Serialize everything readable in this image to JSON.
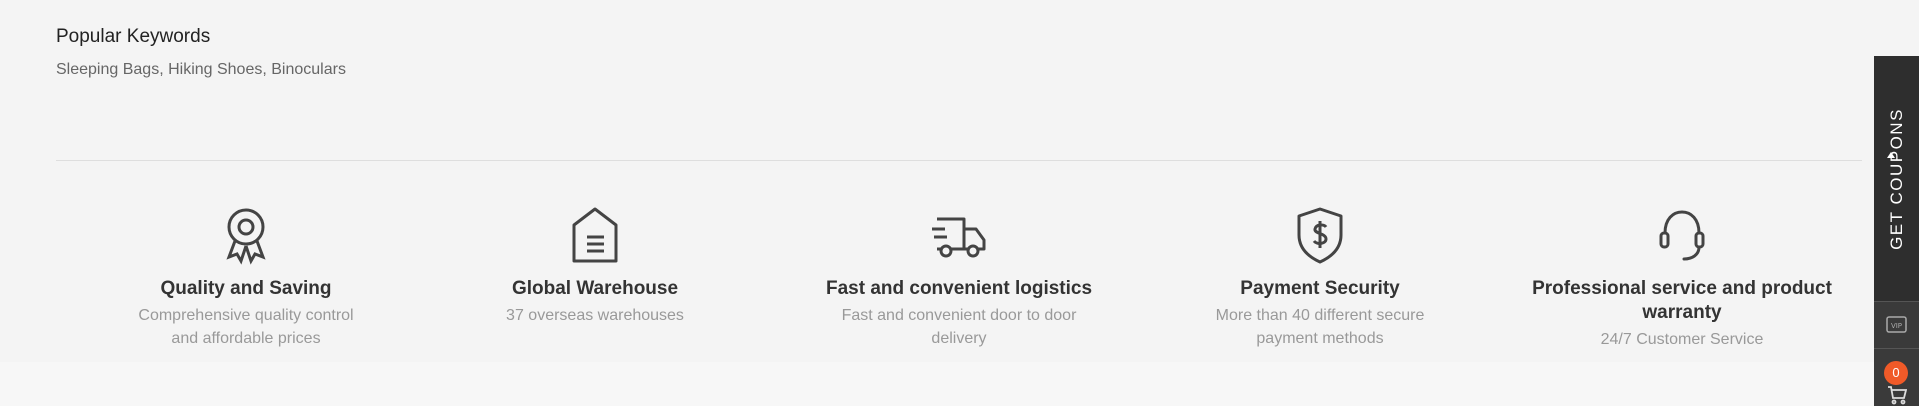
{
  "keywords": {
    "title": "Popular Keywords",
    "list": "Sleeping Bags, Hiking Shoes, Binoculars"
  },
  "features": [
    {
      "icon": "award-ribbon-icon",
      "title": "Quality and Saving",
      "desc": "Comprehensive quality control and affordable prices"
    },
    {
      "icon": "warehouse-icon",
      "title": "Global Warehouse",
      "desc": "37 overseas warehouses"
    },
    {
      "icon": "delivery-truck-icon",
      "title": "Fast and convenient logistics",
      "desc": "Fast and convenient door to door delivery"
    },
    {
      "icon": "shield-dollar-icon",
      "title": "Payment Security",
      "desc": "More than 40 different secure payment methods"
    },
    {
      "icon": "headset-icon",
      "title": "Professional service and product warranty",
      "desc": "24/7 Customer Service"
    }
  ],
  "sidebar": {
    "coupon_label": "GET COUPONS",
    "vip_icon": "vip-icon",
    "cart_icon": "cart-icon",
    "cart_count": "0"
  },
  "colors": {
    "page_bg": "#f4f4f4",
    "sidebar_bg": "#2e2e2e",
    "badge": "#f05a28",
    "icon_stroke": "#444444"
  }
}
